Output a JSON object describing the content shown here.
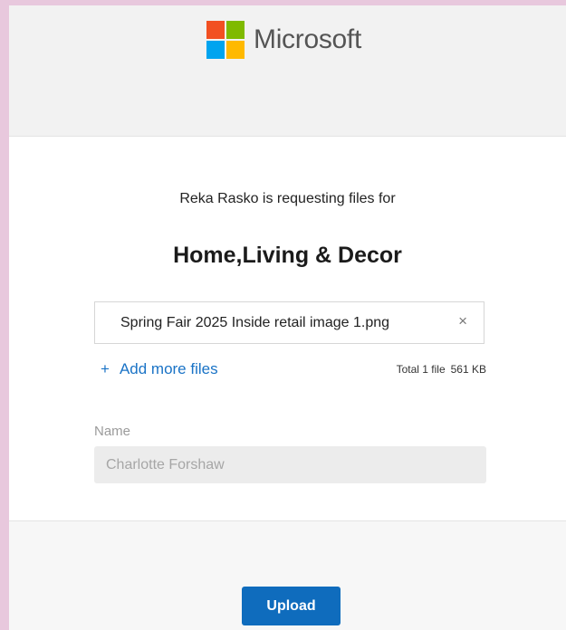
{
  "brand": {
    "name": "Microsoft",
    "logo_colors": [
      "#f25022",
      "#7fba00",
      "#00a4ef",
      "#ffb900"
    ]
  },
  "request": {
    "message": "Reka Rasko is requesting files for",
    "folder_name": "Home,Living & Decor"
  },
  "files": {
    "items": [
      {
        "name": "Spring Fair 2025 Inside retail image 1.png",
        "remove_symbol": "×"
      }
    ],
    "add_more_icon": "+",
    "add_more_label": "Add more files",
    "total_label": "Total 1 file",
    "total_size": "561 KB"
  },
  "form": {
    "name_label": "Name",
    "name_value": "Charlotte Forshaw"
  },
  "footer": {
    "upload_label": "Upload"
  },
  "colors": {
    "accent": "#0f6cbd",
    "link": "#1a73c6",
    "page_background": "#e8c8dd"
  }
}
